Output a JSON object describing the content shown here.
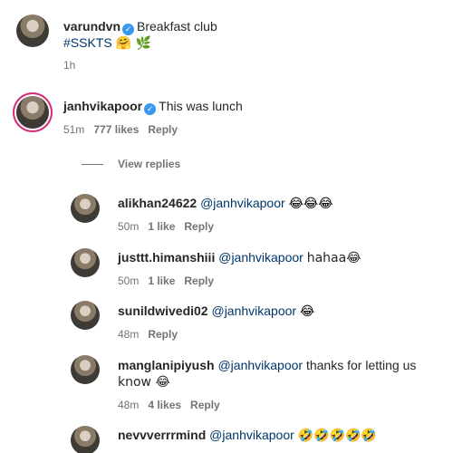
{
  "post": {
    "username": "varundvn",
    "caption": "Breakfast club",
    "hashtag": "#SSKTS",
    "emojis": "🤗 🌿",
    "time": "1h"
  },
  "comment": {
    "username": "janhvikapoor",
    "text": "This was lunch",
    "time": "51m",
    "likes": "777 likes",
    "reply_label": "Reply",
    "view_replies_label": "View replies"
  },
  "replies": [
    {
      "username": "alikhan24622",
      "mention": "@janhvikapoor",
      "text": "😂😂😂",
      "time": "50m",
      "likes": "1 like",
      "reply_label": "Reply"
    },
    {
      "username": "justtt.himanshiii",
      "mention": "@janhvikapoor",
      "text": "hahaa😂",
      "time": "50m",
      "likes": "1 like",
      "reply_label": "Reply"
    },
    {
      "username": "sunildwivedi02",
      "mention": "@janhvikapoor",
      "text": "😂",
      "time": "48m",
      "likes": "",
      "reply_label": "Reply"
    },
    {
      "username": "manglanipiyush",
      "mention": "@janhvikapoor",
      "text": "thanks for letting us",
      "text2": "know 😂",
      "time": "48m",
      "likes": "4 likes",
      "reply_label": "Reply"
    },
    {
      "username": "nevvverrrmind",
      "mention": "@janhvikapoor",
      "text": "🤣🤣🤣🤣🤣",
      "time": "",
      "likes": "",
      "reply_label": ""
    }
  ],
  "colors": {
    "verified": "#3897f0",
    "ring": "#d62976",
    "link": "#00376b",
    "meta": "#737373"
  }
}
